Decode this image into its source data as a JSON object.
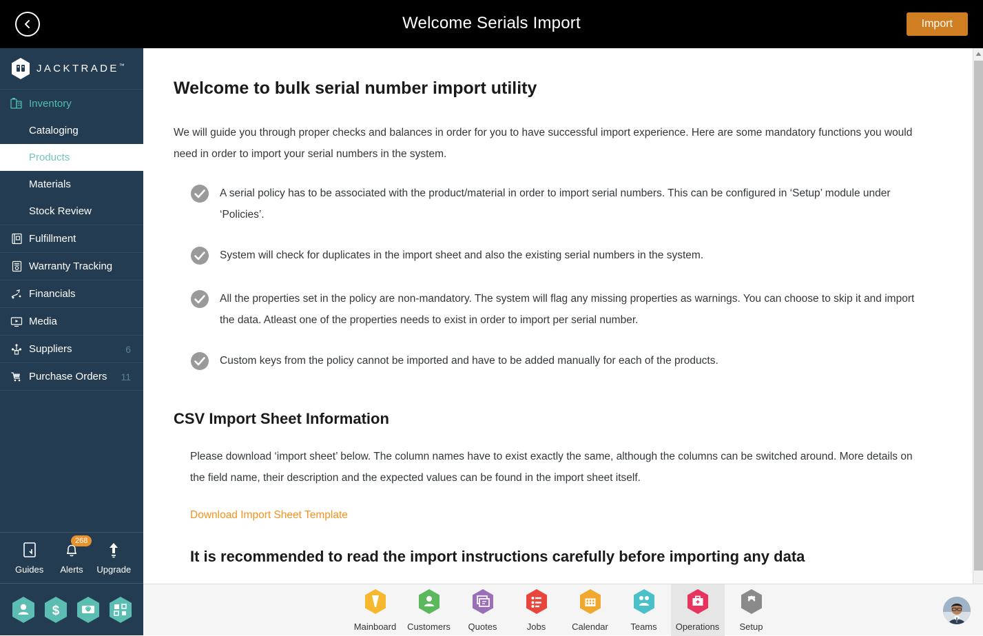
{
  "topbar": {
    "back_icon": "chevron-left-icon",
    "title": "Welcome Serials Import",
    "import_label": "Import"
  },
  "sidebar": {
    "brand": "JACKTRADE",
    "brand_tm": "™",
    "items": [
      {
        "label": "Inventory",
        "icon": "inventory-icon",
        "type": "section",
        "count": ""
      },
      {
        "label": "Cataloging",
        "icon": "",
        "type": "sub",
        "count": ""
      },
      {
        "label": "Products",
        "icon": "",
        "type": "sub-active",
        "count": ""
      },
      {
        "label": "Materials",
        "icon": "",
        "type": "sub",
        "count": ""
      },
      {
        "label": "Stock Review",
        "icon": "",
        "type": "sub",
        "count": ""
      },
      {
        "label": "Fulfillment",
        "icon": "fulfillment-icon",
        "type": "item",
        "count": ""
      },
      {
        "label": "Warranty Tracking",
        "icon": "warranty-icon",
        "type": "item",
        "count": ""
      },
      {
        "label": "Financials",
        "icon": "financials-icon",
        "type": "item",
        "count": ""
      },
      {
        "label": "Media",
        "icon": "media-icon",
        "type": "item",
        "count": ""
      },
      {
        "label": "Suppliers",
        "icon": "suppliers-icon",
        "type": "item",
        "count": "6"
      },
      {
        "label": "Purchase Orders",
        "icon": "purchase-orders-icon",
        "type": "item",
        "count": "11"
      }
    ],
    "tools": [
      {
        "label": "Guides",
        "icon": "book-icon",
        "badge": ""
      },
      {
        "label": "Alerts",
        "icon": "bell-icon",
        "badge": "268"
      },
      {
        "label": "Upgrade",
        "icon": "up-arrow-icon",
        "badge": ""
      }
    ],
    "quick_hexes": [
      {
        "icon": "person-hex-icon"
      },
      {
        "icon": "dollar-hex-icon"
      },
      {
        "icon": "money-hex-icon"
      },
      {
        "icon": "scan-hex-icon"
      }
    ]
  },
  "main": {
    "title": "Welcome to bulk serial number import utility",
    "intro": "We will guide you through proper checks and balances in order for you to have successful import experience. Here are some mandatory functions you would need in order to import your serial numbers in the system.",
    "checks": [
      "A serial policy has to be associated with the product/material in order to import serial numbers. This can be configured in ‘Setup’ module under ‘Policies’.",
      "System will check for duplicates in the import sheet and also the existing serial numbers in the system.",
      "All the properties set in the policy are non-mandatory. The system will flag any missing properties as warnings. You can choose to skip it and import the data. Atleast one of the properties needs to exist in order to import per serial number.",
      "Custom keys from the policy cannot be imported and have to be added manually for each of the products."
    ],
    "csv_title": "CSV Import Sheet Information",
    "csv_body": "Please download ‘import sheet’ below. The column names have to exist exactly the same, although the columns can be switched around. More details on the field name, their description and the expected values can be found in the import sheet itself.",
    "download_link": "Download Import Sheet Template",
    "cutoff_title": "It is recommended to read the import instructions carefully before importing any data"
  },
  "taskbar": {
    "items": [
      {
        "label": "Mainboard",
        "icon": "mainboard-icon",
        "color": "#f5b82e",
        "active": false
      },
      {
        "label": "Customers",
        "icon": "customers-icon",
        "color": "#5cb85c",
        "active": false
      },
      {
        "label": "Quotes",
        "icon": "quotes-icon",
        "color": "#9b6fb8",
        "active": false
      },
      {
        "label": "Jobs",
        "icon": "jobs-icon",
        "color": "#e8453c",
        "active": false
      },
      {
        "label": "Calendar",
        "icon": "calendar-icon",
        "color": "#f0a92e",
        "active": false
      },
      {
        "label": "Teams",
        "icon": "teams-icon",
        "color": "#4bc0c8",
        "active": false
      },
      {
        "label": "Operations",
        "icon": "operations-icon",
        "color": "#e6345e",
        "active": true
      },
      {
        "label": "Setup",
        "icon": "setup-icon",
        "color": "#8a8a8a",
        "active": false
      }
    ],
    "avatar": "user-avatar"
  },
  "colors": {
    "sidebar_bg": "#233c51",
    "accent_teal": "#4fbfb0",
    "accent_orange": "#f5921e",
    "import_btn": "#cf7f21",
    "check_gray": "#9a9a9a"
  }
}
